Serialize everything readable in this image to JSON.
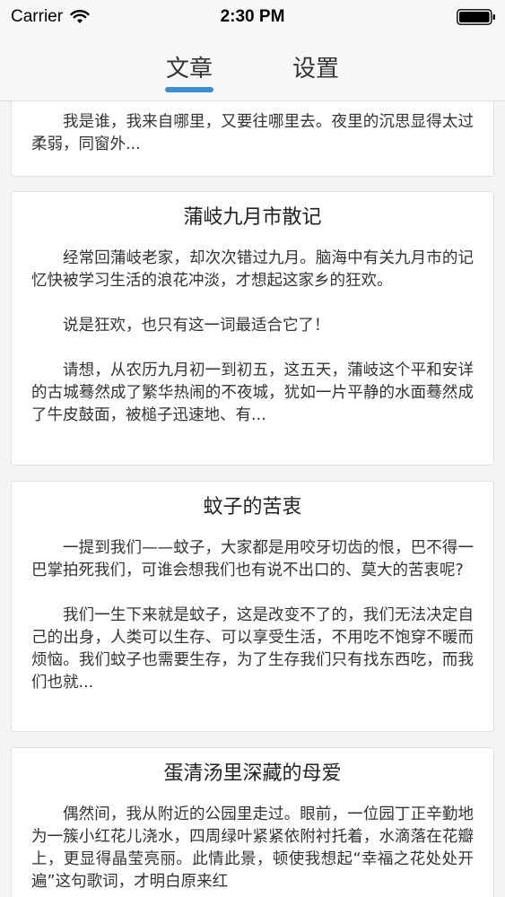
{
  "status_bar": {
    "carrier": "Carrier",
    "time": "2:30 PM"
  },
  "tabs": [
    {
      "label": "文章"
    },
    {
      "label": "设置"
    }
  ],
  "colors": {
    "accent": "#3a8fd0"
  },
  "articles": [
    {
      "title": "",
      "paragraphs": [
        "我是谁，我来自哪里，又要往哪里去。夜里的沉思显得太过柔弱，同窗外..."
      ]
    },
    {
      "title": "蒲岐九月市散记",
      "paragraphs": [
        "经常回蒲岐老家，却次次错过九月。脑海中有关九月市的记忆快被学习生活的浪花冲淡，才想起这家乡的狂欢。",
        "说是狂欢，也只有这一词最适合它了！",
        "请想，从农历九月初一到初五，这五天，蒲岐这个平和安详的古城蓦然成了繁华热闹的不夜城，犹如一片平静的水面蓦然成了牛皮鼓面，被槌子迅速地、有..."
      ]
    },
    {
      "title": "蚊子的苦衷",
      "paragraphs": [
        "一提到我们——蚊子，大家都是用咬牙切齿的恨，巴不得一巴掌拍死我们，可谁会想我们也有说不出口的、莫大的苦衷呢?",
        "我们一生下来就是蚊子，这是改变不了的，我们无法决定自己的出身，人类可以生存、可以享受生活，不用吃不饱穿不暖而烦恼。我们蚊子也需要生存，为了生存我们只有找东西吃，而我们也就..."
      ]
    },
    {
      "title": "蛋清汤里深藏的母爱",
      "paragraphs": [
        "偶然间，我从附近的公园里走过。眼前，一位园丁正辛勤地为一簇小红花儿浇水，四周绿叶紧紧依附衬托着，水滴落在花瓣上，更显得晶莹亮丽。此情此景，顿使我想起“幸福之花处处开遍”这句歌词，才明白原来红"
      ]
    }
  ]
}
